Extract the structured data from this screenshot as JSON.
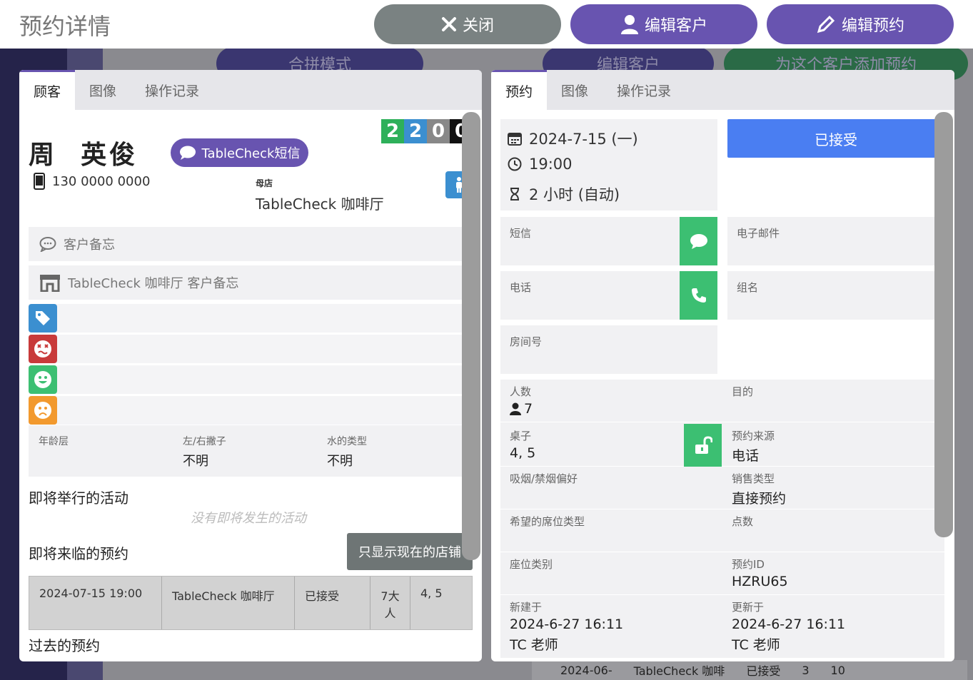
{
  "header": {
    "title": "预约详情",
    "close_label": "关闭",
    "edit_customer_label": "编辑客户",
    "edit_reservation_label": "编辑预约"
  },
  "background": {
    "merge_mode_label": "合拼模式",
    "edit_customer_label": "编辑客户",
    "add_reservation_label": "为这个客户添加预约",
    "bottom_row": {
      "date": "2024-06-",
      "store": "TableCheck 咖啡",
      "status": "已接受",
      "count": "3",
      "table": "10"
    }
  },
  "left_panel": {
    "tabs": [
      "顾客",
      "图像",
      "操作记录"
    ],
    "score": [
      "2",
      "2",
      "0",
      "0"
    ],
    "customer_name": "周  英俊",
    "sms_label": "TableCheck短信",
    "phone": "130 0000 0000",
    "home_store_label": "母店",
    "home_store": "TableCheck 咖啡厅",
    "memo_label": "客户备忘",
    "store_memo_label": "TableCheck 咖啡厅 客户备忘",
    "attributes": [
      {
        "label": "年龄层",
        "value": ""
      },
      {
        "label": "左/右撇子",
        "value": "不明"
      },
      {
        "label": "水的类型",
        "value": "不明"
      }
    ],
    "upcoming_events_title": "即将举行的活动",
    "no_events_text": "没有即将发生的活动",
    "upcoming_reservations_title": "即将来临的预约",
    "only_current_store_label": "只显示现在的店铺",
    "upcoming_row": {
      "datetime": "2024-07-15 19:00",
      "store": "TableCheck 咖啡厅",
      "status": "已接受",
      "guests": "7大人",
      "table": "4, 5"
    },
    "past_reservations_title": "过去的预约"
  },
  "right_panel": {
    "tabs": [
      "预约",
      "图像",
      "操作记录"
    ],
    "date": "2024-7-15 (一)",
    "time": "19:00",
    "duration": "2 小时 (自动)",
    "status_label": "已接受",
    "contacts": {
      "sms_label": "短信",
      "email_label": "电子邮件",
      "phone_label": "电话",
      "group_label": "组名",
      "room_label": "房间号"
    },
    "info": {
      "guests_label": "人数",
      "guests_value": "7",
      "purpose_label": "目的",
      "purpose_value": "",
      "table_label": "桌子",
      "table_value": "4, 5",
      "source_label": "预约来源",
      "source_value": "电话",
      "smoking_label": "吸烟/禁烟偏好",
      "smoking_value": "",
      "sales_type_label": "销售类型",
      "sales_type_value": "直接预约",
      "seat_pref_label": "希望的席位类型",
      "seat_pref_value": "",
      "points_label": "点数",
      "points_value": "",
      "seat_cat_label": "座位类别",
      "seat_cat_value": "",
      "resv_id_label": "预约ID",
      "resv_id_value": "HZRU65",
      "created_label": "新建于",
      "created_value": "2024-6-27 16:11",
      "created_by": "TC 老师",
      "updated_label": "更新于",
      "updated_value": "2024-6-27 16:11",
      "updated_by": "TC 老师"
    }
  },
  "colors": {
    "brand_purple": "#6854b0",
    "close_gray": "#7a8282",
    "accept_blue": "#4a7ef2",
    "action_green": "#3cbf72",
    "tag_blue": "#3b8fd0",
    "tag_red": "#c83a3a",
    "tag_green": "#3cbf72",
    "tag_orange": "#f2992e",
    "score_colors": [
      "#2eb05a",
      "#3b8fd0",
      "#888888",
      "#111111"
    ]
  },
  "icons": [
    "close-icon",
    "user-icon",
    "pencil-icon",
    "chat-icon",
    "mobile-phone-icon",
    "person-icon",
    "comment-icon",
    "store-icon",
    "tag-icon",
    "dizzy-face-icon",
    "smile-face-icon",
    "frown-face-icon",
    "calendar-icon",
    "clock-icon",
    "hourglass-icon",
    "phone-icon",
    "unlock-icon"
  ]
}
